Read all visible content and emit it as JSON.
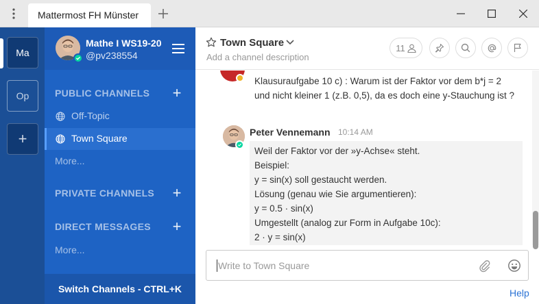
{
  "window": {
    "tab_title": "Mattermost FH Münster",
    "menu_icon": "kebab-menu-icon",
    "new_tab_icon": "plus-icon",
    "controls": [
      "minimize-icon",
      "maximize-icon",
      "close-icon"
    ]
  },
  "teams": {
    "items": [
      {
        "label": "Ma",
        "active": true
      },
      {
        "label": "Op",
        "active": false
      }
    ],
    "add_label": "+"
  },
  "sidebar": {
    "team_name": "Mathe I WS19-20",
    "username": "@pv238554",
    "status_color": "#06d6a0",
    "public_channels": {
      "title": "PUBLIC CHANNELS",
      "add_label": "+",
      "items": [
        {
          "label": "Off-Topic",
          "active": false
        },
        {
          "label": "Town Square",
          "active": true
        }
      ],
      "more": "More..."
    },
    "private_channels": {
      "title": "PRIVATE CHANNELS",
      "add_label": "+"
    },
    "direct_messages": {
      "title": "DIRECT MESSAGES",
      "add_label": "+",
      "more": "More..."
    },
    "switch_channels": "Switch Channels - CTRL+K"
  },
  "header": {
    "channel_name": "Town Square",
    "description_placeholder": "Add a channel description",
    "member_count": "11",
    "icons": [
      "star-icon",
      "chevron-down-icon",
      "member-icon",
      "pin-icon",
      "search-icon",
      "at-mention-icon",
      "flag-icon"
    ]
  },
  "messages": {
    "previous_text": "Klausuraufgabe 10 c) : Warum ist der Faktor vor dem b*j = 2 und nicht kleiner 1 (z.B. 0,5), da es doch eine y-Stauchung ist ?",
    "previous_status_color": "#f0b429",
    "post": {
      "author": "Peter Vennemann",
      "time": "10:14 AM",
      "lines": [
        "Weil der Faktor vor der »y-Achse« steht.",
        "Beispiel:",
        "y = sin(x) soll gestaucht werden.",
        "Lösung (genau wie Sie argumentieren):",
        "y = 0.5 · sin(x)",
        "Umgestellt (analog zur Form in Aufgabe 10c):",
        "2 · y = sin(x)"
      ]
    }
  },
  "input": {
    "placeholder": "Write to Town Square",
    "icons": [
      "attachment-icon",
      "emoji-icon"
    ]
  },
  "footer": {
    "help": "Help"
  },
  "colors": {
    "team_sidebar": "#1b4f96",
    "channel_sidebar": "#1e63c4",
    "link": "#2a72d4"
  }
}
